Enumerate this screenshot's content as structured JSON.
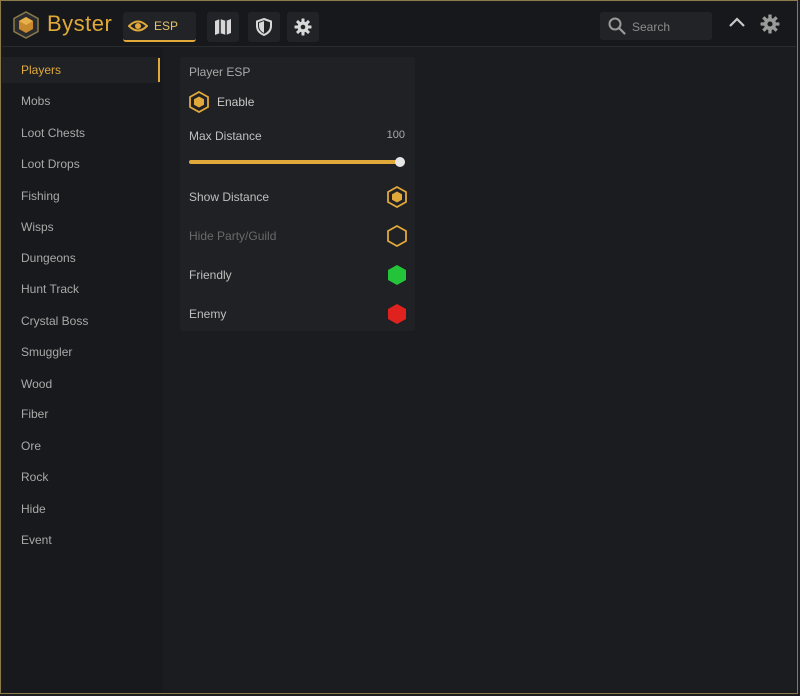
{
  "app": {
    "title": "Byster"
  },
  "tabs": {
    "esp_label": "ESP"
  },
  "search": {
    "placeholder": "Search"
  },
  "sidebar": {
    "items": [
      {
        "label": "Players",
        "active": true
      },
      {
        "label": "Mobs"
      },
      {
        "label": "Loot Chests"
      },
      {
        "label": "Loot Drops"
      },
      {
        "label": "Fishing"
      },
      {
        "label": "Wisps"
      },
      {
        "label": "Dungeons"
      },
      {
        "label": "Hunt Track"
      },
      {
        "label": "Crystal Boss"
      },
      {
        "label": "Smuggler"
      },
      {
        "label": "Wood"
      },
      {
        "label": "Fiber"
      },
      {
        "label": "Ore"
      },
      {
        "label": "Rock"
      },
      {
        "label": "Hide"
      },
      {
        "label": "Event"
      }
    ]
  },
  "panel": {
    "title": "Player ESP",
    "enable_label": "Enable",
    "max_distance_label": "Max Distance",
    "max_distance_value": "100",
    "max_distance_fraction": 1.0,
    "show_distance_label": "Show Distance",
    "hide_party_label": "Hide Party/Guild",
    "friendly_label": "Friendly",
    "enemy_label": "Enemy"
  },
  "colors": {
    "accent": "#e0a93a",
    "friendly": "#23c33a",
    "enemy": "#e0221e"
  }
}
